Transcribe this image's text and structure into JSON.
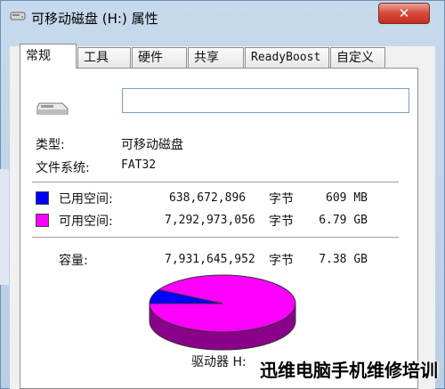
{
  "window": {
    "title": "可移动磁盘 (H:) 属性",
    "close_label": "✕"
  },
  "tabs": [
    {
      "label": "常规",
      "active": true
    },
    {
      "label": "工具",
      "active": false
    },
    {
      "label": "硬件",
      "active": false
    },
    {
      "label": "共享",
      "active": false
    },
    {
      "label": "ReadyBoost",
      "active": false
    },
    {
      "label": "自定义",
      "active": false
    }
  ],
  "general": {
    "name_value": "",
    "type_label": "类型:",
    "type_value": "可移动磁盘",
    "fs_label": "文件系统:",
    "fs_value": "FAT32",
    "used": {
      "label": "已用空间:",
      "bytes": "638,672,896",
      "unit": "字节",
      "size": "609 MB",
      "color": "#0000ff"
    },
    "free": {
      "label": "可用空间:",
      "bytes": "7,292,973,056",
      "unit": "字节",
      "size": "6.79 GB",
      "color": "#ff00ff"
    },
    "capacity": {
      "label": "容量:",
      "bytes": "7,931,645,952",
      "unit": "字节",
      "size": "7.38 GB"
    },
    "drive_label": "驱动器 H:"
  },
  "pie": {
    "used_fraction": 0.0805,
    "used_color": "#0000ff",
    "free_color": "#ff00ff",
    "free_side_color": "#8b008b",
    "used_side_color": "#00008b"
  },
  "watermark": "迅维电脑手机维修培训"
}
